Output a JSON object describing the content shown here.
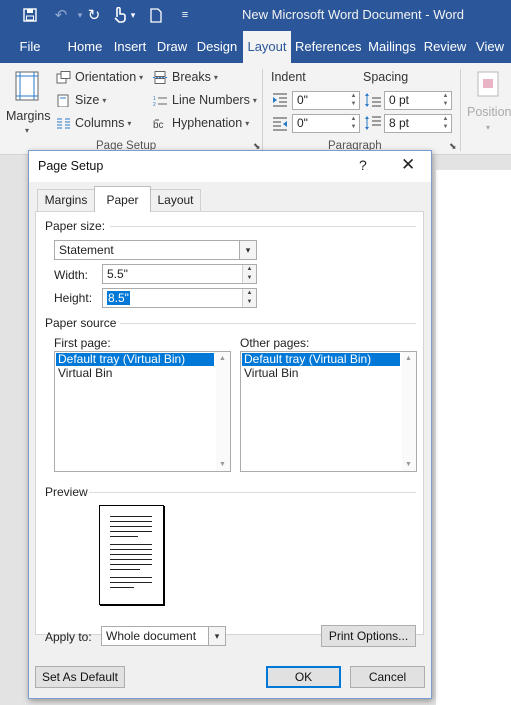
{
  "titlebar": {
    "title": "New Microsoft Word Document  -  Word",
    "bg_color": "#2b579a",
    "icons": [
      "save-icon",
      "undo-icon",
      "redo-icon",
      "touch-mode-icon",
      "new-document-icon",
      "customize-qat-icon"
    ]
  },
  "tabs": [
    "File",
    "Home",
    "Insert",
    "Draw",
    "Design",
    "Layout",
    "References",
    "Mailings",
    "Review",
    "View"
  ],
  "active_tab": "Layout",
  "ribbon": {
    "margins": "Margins",
    "orientation": "Orientation",
    "size": "Size",
    "columns": "Columns",
    "breaks": "Breaks",
    "line_numbers": "Line Numbers",
    "hyphenation": "Hyphenation",
    "page_setup_group": "Page Setup",
    "indent": {
      "label": "Indent",
      "left": "0\"",
      "right": "0\""
    },
    "spacing": {
      "label": "Spacing",
      "before": "0 pt",
      "after": "8 pt"
    },
    "paragraph_group": "Paragraph",
    "position": "Position"
  },
  "dialog": {
    "title": "Page Setup",
    "help": "?",
    "close": "✕",
    "tabs": [
      "Margins",
      "Paper",
      "Layout"
    ],
    "active_tab": "Paper",
    "paper_size_label": "Paper size:",
    "paper_size_value": "Statement",
    "width_label": "Width:",
    "width_value": "5.5\"",
    "height_label": "Height:",
    "height_value": "8.5\"",
    "paper_source_label": "Paper source",
    "first_page_label": "First page:",
    "first_page_items": [
      "Default tray (Virtual Bin)",
      "Virtual Bin"
    ],
    "other_pages_label": "Other pages:",
    "other_pages_items": [
      "Default tray (Virtual Bin)",
      "Virtual Bin"
    ],
    "preview_label": "Preview",
    "apply_to_label": "Apply to:",
    "apply_to_value": "Whole document",
    "print_options": "Print Options...",
    "set_default": "Set As Default",
    "ok": "OK",
    "cancel": "Cancel",
    "accent_color": "#0078d7"
  }
}
